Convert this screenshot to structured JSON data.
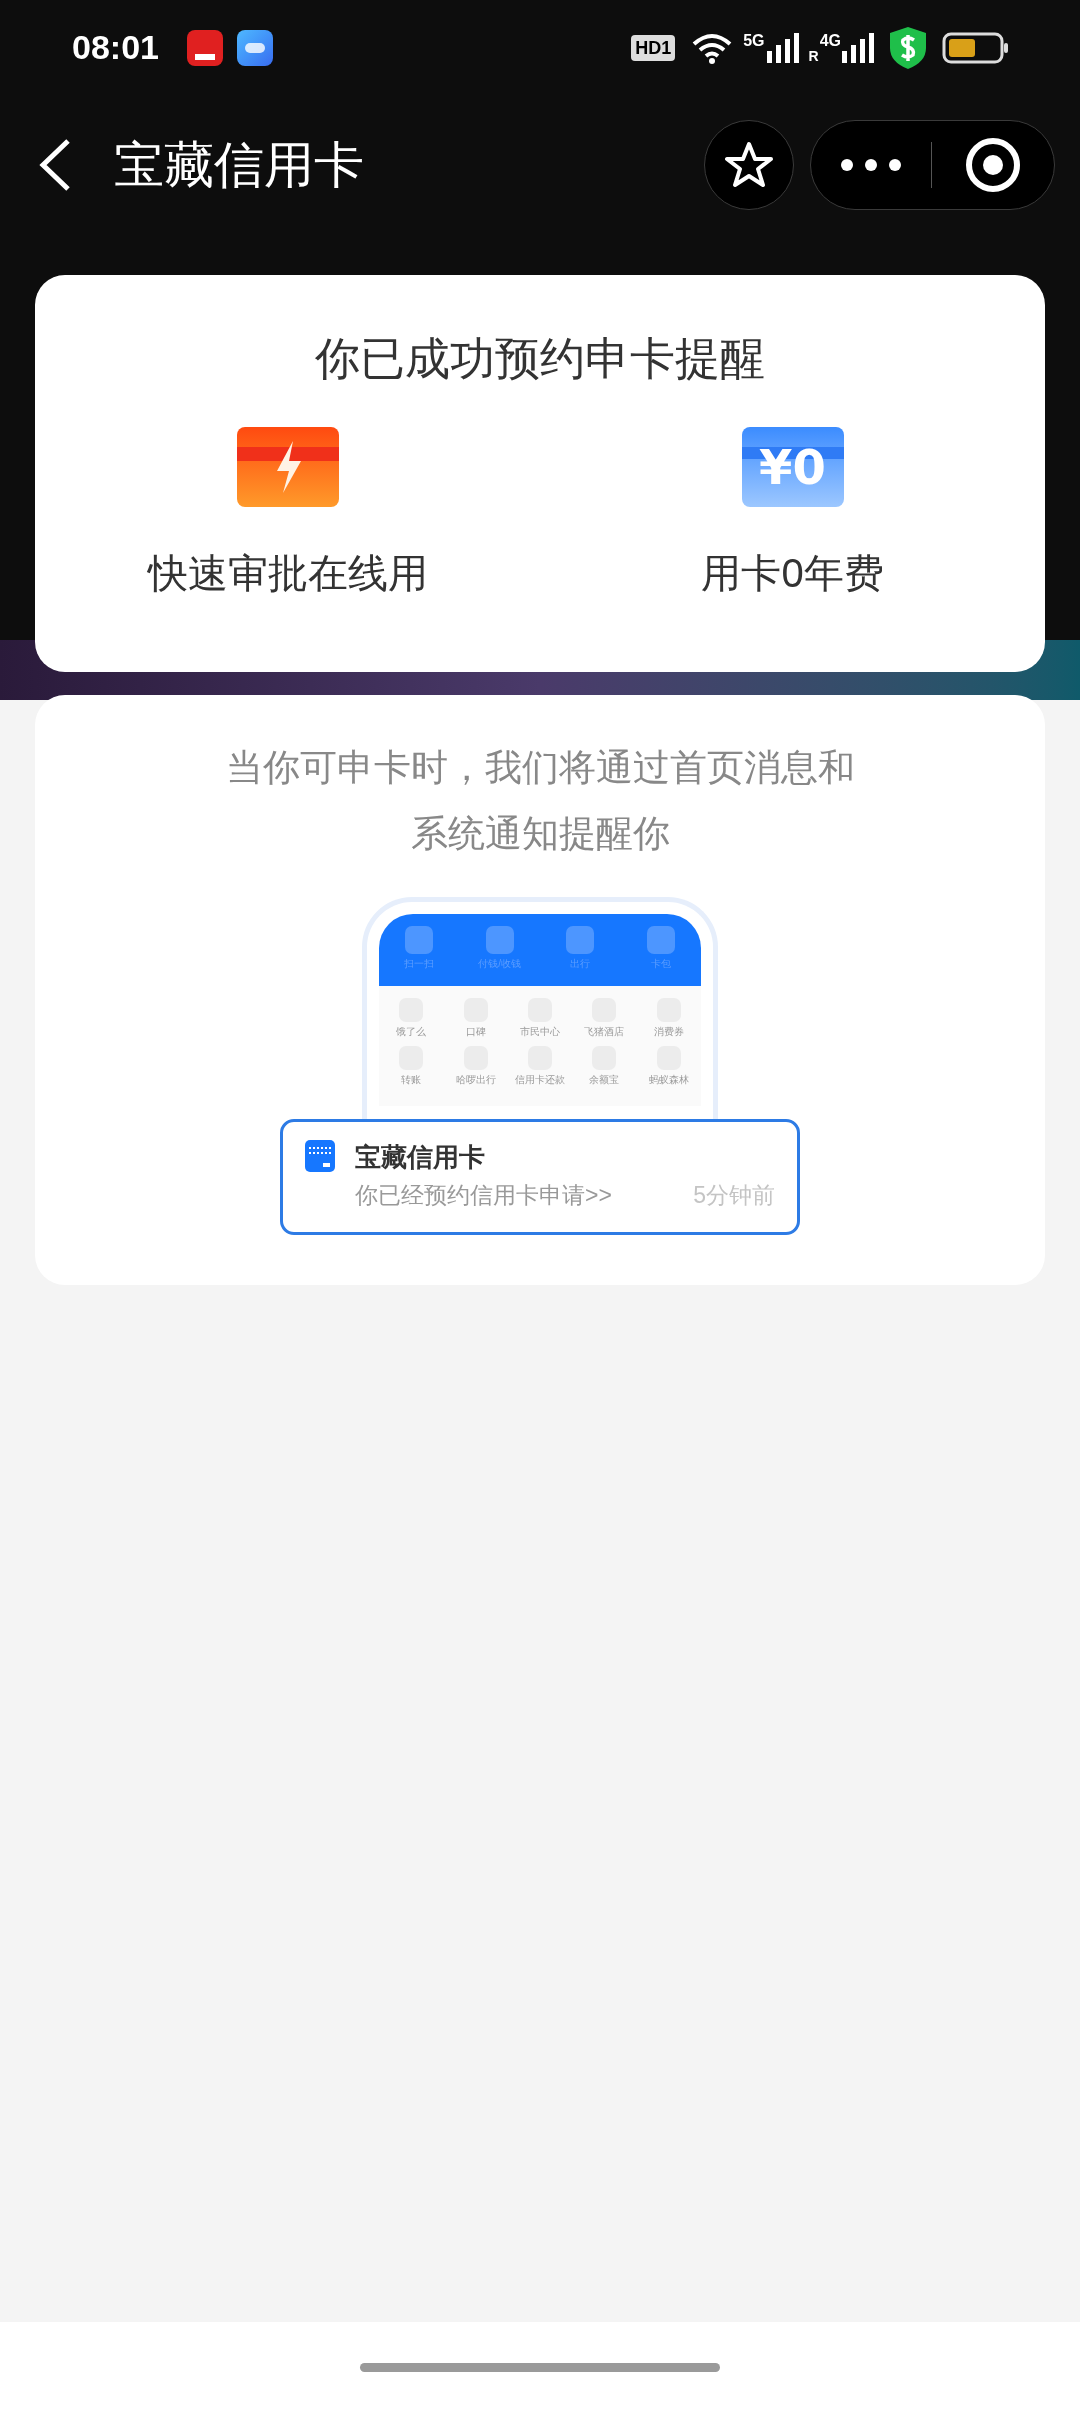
{
  "status_bar": {
    "time": "08:01",
    "hd": "HD1",
    "net1": "5G",
    "net2": "4G",
    "roaming": "R"
  },
  "header": {
    "title": "宝藏信用卡"
  },
  "success_card": {
    "title": "你已成功预约申卡提醒",
    "features": [
      {
        "kind": "fast",
        "label": "快速审批在线用"
      },
      {
        "kind": "fee",
        "badge": "¥0",
        "label": "用卡0年费"
      }
    ]
  },
  "info_card": {
    "message": "当你可申卡时，我们将通过首页消息和系统通知提醒你",
    "phone": {
      "top_items": [
        "扫一扫",
        "付钱/收钱",
        "出行",
        "卡包"
      ],
      "grid_items": [
        "饿了么",
        "口碑",
        "市民中心",
        "飞猪酒店",
        "消费券",
        "转账",
        "哈啰出行",
        "信用卡还款",
        "余额宝",
        "蚂蚁森林"
      ]
    },
    "notification": {
      "title": "宝藏信用卡",
      "text": "你已经预约信用卡申请>>",
      "time": "5分钟前"
    }
  }
}
